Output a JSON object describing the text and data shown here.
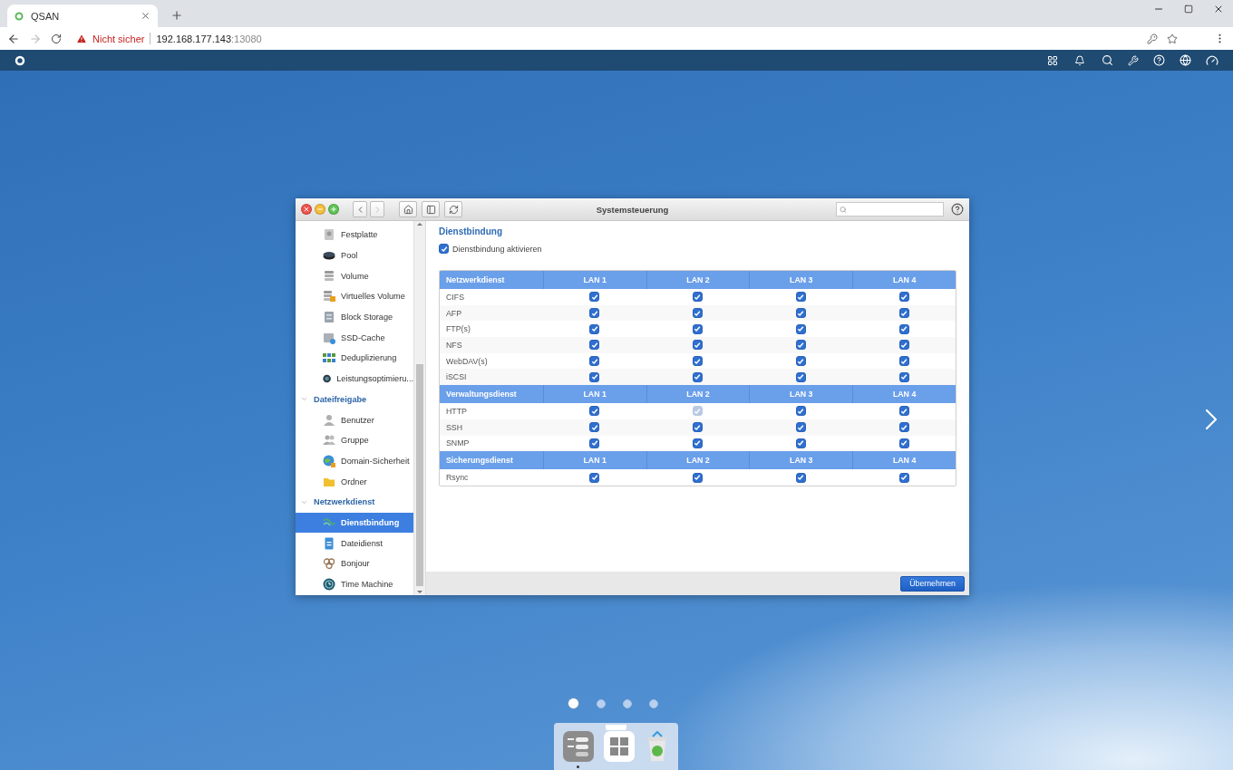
{
  "browser": {
    "tab": {
      "title": "QSAN"
    },
    "security": "Nicht sicher",
    "address": {
      "host": "192.168.177.143",
      "port": ":13080"
    }
  },
  "window": {
    "title": "Systemsteuerung"
  },
  "sidebar": {
    "items": [
      {
        "kind": "item",
        "label": "Festplatte",
        "selected": false
      },
      {
        "kind": "item",
        "label": "Pool",
        "selected": false
      },
      {
        "kind": "item",
        "label": "Volume",
        "selected": false
      },
      {
        "kind": "item",
        "label": "Virtuelles Volume",
        "selected": false
      },
      {
        "kind": "item",
        "label": "Block Storage",
        "selected": false
      },
      {
        "kind": "item",
        "label": "SSD-Cache",
        "selected": false
      },
      {
        "kind": "item",
        "label": "Deduplizierung",
        "selected": false
      },
      {
        "kind": "item",
        "label": "Leistungsoptimieru...",
        "selected": false
      },
      {
        "kind": "group",
        "label": "Dateifreigabe",
        "expanded": true,
        "children": [
          {
            "label": "Benutzer",
            "selected": false
          },
          {
            "label": "Gruppe",
            "selected": false
          },
          {
            "label": "Domain-Sicherheit",
            "selected": false
          },
          {
            "label": "Ordner",
            "selected": false
          }
        ]
      },
      {
        "kind": "group",
        "label": "Netzwerkdienst",
        "expanded": true,
        "children": [
          {
            "label": "Dienstbindung",
            "selected": true
          },
          {
            "label": "Dateidienst",
            "selected": false
          },
          {
            "label": "Bonjour",
            "selected": false
          },
          {
            "label": "Time Machine",
            "selected": false
          }
        ]
      }
    ]
  },
  "content": {
    "title": "Dienstbindung",
    "enable": {
      "label": "Dienstbindung aktivieren",
      "checked": true
    },
    "sections": [
      {
        "header": "Netzwerkdienst",
        "columns": [
          "LAN 1",
          "LAN 2",
          "LAN 3",
          "LAN 4"
        ],
        "rows": [
          {
            "name": "CIFS",
            "cells": [
              {
                "checked": true,
                "disabled": false
              },
              {
                "checked": true,
                "disabled": false
              },
              {
                "checked": true,
                "disabled": false
              },
              {
                "checked": true,
                "disabled": false
              }
            ]
          },
          {
            "name": "AFP",
            "cells": [
              {
                "checked": true,
                "disabled": false
              },
              {
                "checked": true,
                "disabled": false
              },
              {
                "checked": true,
                "disabled": false
              },
              {
                "checked": true,
                "disabled": false
              }
            ]
          },
          {
            "name": "FTP(s)",
            "cells": [
              {
                "checked": true,
                "disabled": false
              },
              {
                "checked": true,
                "disabled": false
              },
              {
                "checked": true,
                "disabled": false
              },
              {
                "checked": true,
                "disabled": false
              }
            ]
          },
          {
            "name": "NFS",
            "cells": [
              {
                "checked": true,
                "disabled": false
              },
              {
                "checked": true,
                "disabled": false
              },
              {
                "checked": true,
                "disabled": false
              },
              {
                "checked": true,
                "disabled": false
              }
            ]
          },
          {
            "name": "WebDAV(s)",
            "cells": [
              {
                "checked": true,
                "disabled": false
              },
              {
                "checked": true,
                "disabled": false
              },
              {
                "checked": true,
                "disabled": false
              },
              {
                "checked": true,
                "disabled": false
              }
            ]
          },
          {
            "name": "iSCSI",
            "cells": [
              {
                "checked": true,
                "disabled": false
              },
              {
                "checked": true,
                "disabled": false
              },
              {
                "checked": true,
                "disabled": false
              },
              {
                "checked": true,
                "disabled": false
              }
            ]
          }
        ]
      },
      {
        "header": "Verwaltungsdienst",
        "columns": [
          "LAN 1",
          "LAN 2",
          "LAN 3",
          "LAN 4"
        ],
        "rows": [
          {
            "name": "HTTP",
            "cells": [
              {
                "checked": true,
                "disabled": false
              },
              {
                "checked": true,
                "disabled": true
              },
              {
                "checked": true,
                "disabled": false
              },
              {
                "checked": true,
                "disabled": false
              }
            ]
          },
          {
            "name": "SSH",
            "cells": [
              {
                "checked": true,
                "disabled": false
              },
              {
                "checked": true,
                "disabled": false
              },
              {
                "checked": true,
                "disabled": false
              },
              {
                "checked": true,
                "disabled": false
              }
            ]
          },
          {
            "name": "SNMP",
            "cells": [
              {
                "checked": true,
                "disabled": false
              },
              {
                "checked": true,
                "disabled": false
              },
              {
                "checked": true,
                "disabled": false
              },
              {
                "checked": true,
                "disabled": false
              }
            ]
          }
        ]
      },
      {
        "header": "Sicherungsdienst",
        "columns": [
          "LAN 1",
          "LAN 2",
          "LAN 3",
          "LAN 4"
        ],
        "rows": [
          {
            "name": "Rsync",
            "cells": [
              {
                "checked": true,
                "disabled": false
              },
              {
                "checked": true,
                "disabled": false
              },
              {
                "checked": true,
                "disabled": false
              },
              {
                "checked": true,
                "disabled": false
              }
            ]
          }
        ]
      }
    ],
    "apply_button": "Übernehmen"
  },
  "pager": [
    {
      "selected": true
    },
    {
      "selected": false
    },
    {
      "selected": false
    },
    {
      "selected": false
    }
  ]
}
